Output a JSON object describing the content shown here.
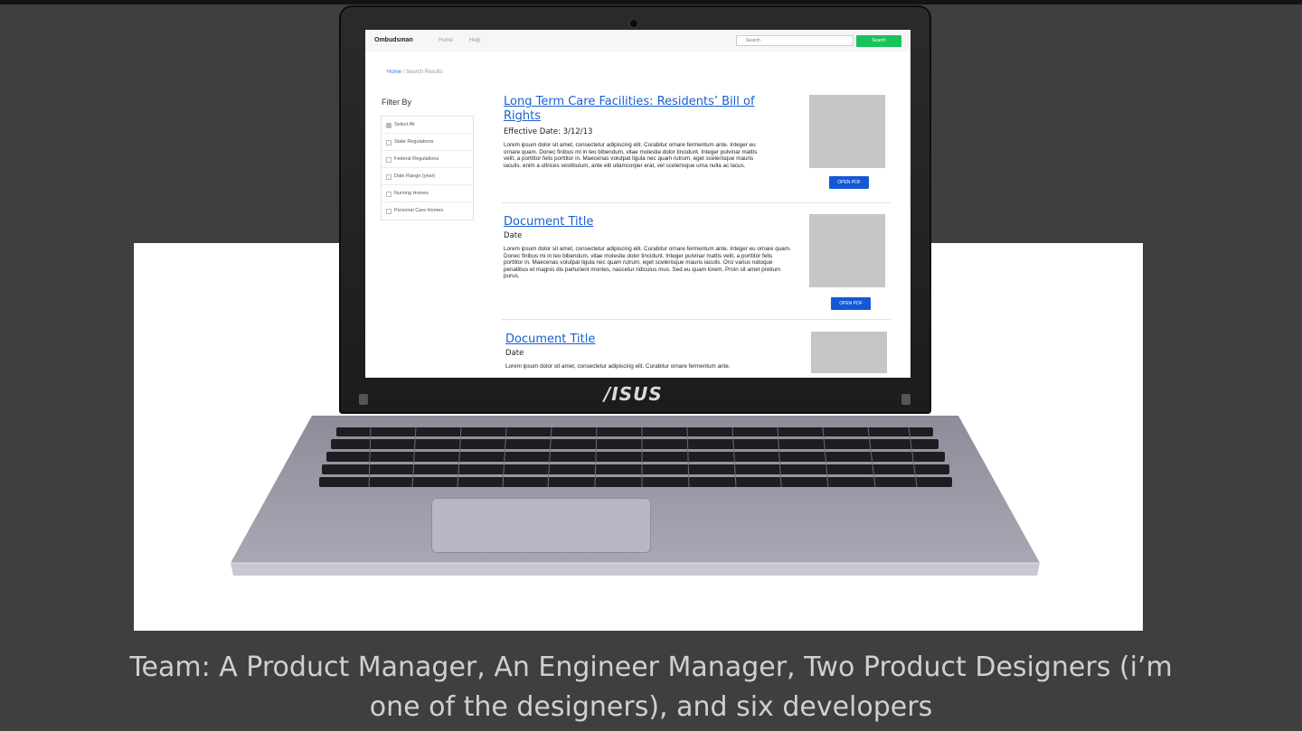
{
  "screen": {
    "navbar": {
      "brand": "Ombudsman",
      "links": [
        "Home",
        "Help"
      ],
      "search_placeholder": "Search",
      "search_button": "Search"
    },
    "breadcrumb": {
      "home": "Home",
      "separator": "/",
      "current": "Search Results"
    },
    "filter": {
      "title": "Filter By",
      "items": [
        {
          "label": "Select All",
          "checked": true
        },
        {
          "label": "State Regulations",
          "checked": false
        },
        {
          "label": "Federal Regulations",
          "checked": false
        },
        {
          "label": "Date Range (year)",
          "checked": false
        },
        {
          "label": "Nursing Homes",
          "checked": false
        },
        {
          "label": "Personal Care Homes",
          "checked": false
        }
      ]
    },
    "results": [
      {
        "title": "Long Term Care Facilities: Residents’ Bill of Rights",
        "date": "Effective Date: 3/12/13",
        "body": "Lorem ipsum dolor sit amet, consectetur adipiscing elit. Curabitur ornare fermentum ante. Integer eu ornare quam. Donec finibus mi in leo bibendum, vitae molestie dolor tincidunt. Integer pulvinar mattis velit, a porttitor felis porttitor in. Maecenas volutpat ligula nec quam rutrum, eget scelerisque mauris iaculis. enim a ultrices vestibulum, ante elit ullamcorper erat, vel scelerisque urna nulla ac lacus.",
        "button": "OPEN PDF"
      },
      {
        "title": "Document Title",
        "date": "Date",
        "body": "Lorem ipsum dolor sit amet, consectetur adipiscing elit. Curabitur ornare fermentum ante. Integer eu ornare quam. Donec finibus mi in leo bibendum, vitae molestie dolor tincidunt. Integer pulvinar mattis velit, a porttitor felis porttitor in. Maecenas volutpat ligula nec quam rutrum, eget scelerisque mauris iaculis. Orci varius natoque penatibus et magnis dis parturient montes, nascetur ridiculus mus. Sed eu quam lorem. Proin sit amet pretium purus.",
        "button": "OPEN PDF"
      },
      {
        "title": "Document Title",
        "date": "Date",
        "body": "Lorem ipsum dolor sit amet, consectetur adipiscing elit. Curabitur ornare fermentum ante."
      }
    ]
  },
  "laptop": {
    "brand": "/ISUS"
  },
  "caption": {
    "line1": "Team: A Product Manager, An Engineer Manager, Two Product Designers (i’m",
    "line2": "one of the designers), and six developers"
  },
  "colors": {
    "slide_background": "#3f3f3f",
    "search_button": "#19c25a",
    "link_blue": "#1a5fd0",
    "pdf_button": "#1558d6"
  }
}
